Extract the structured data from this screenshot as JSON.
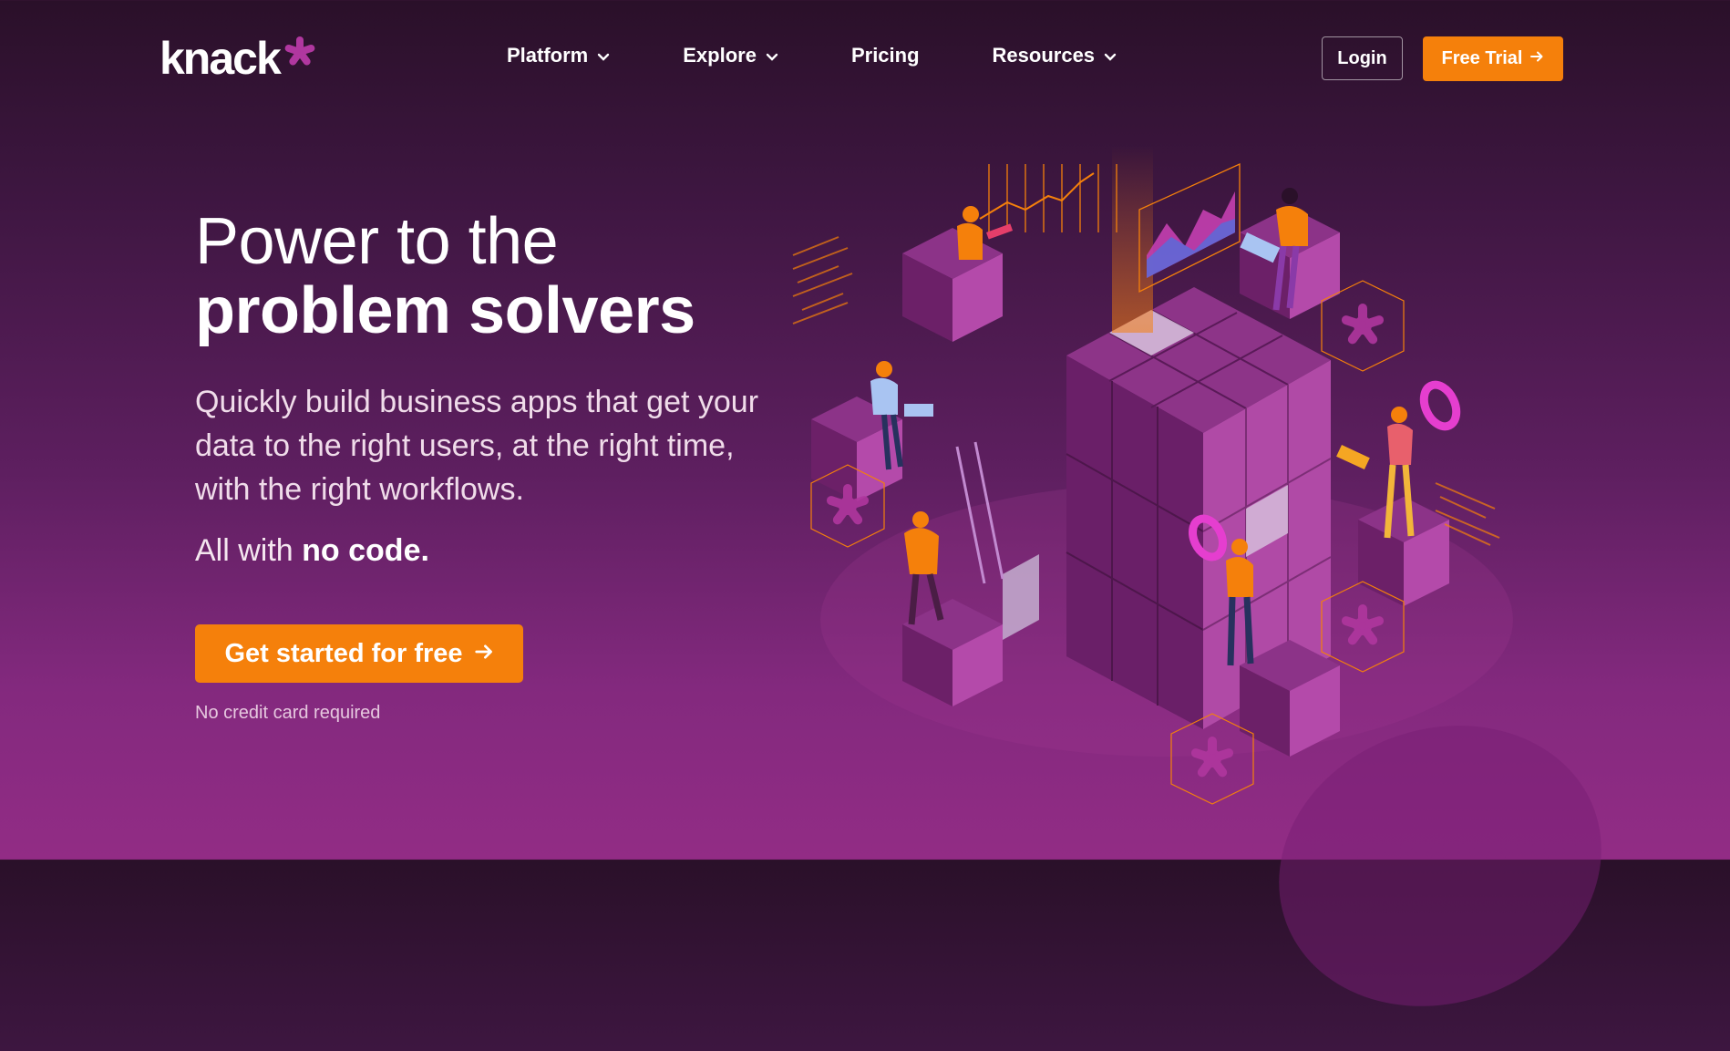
{
  "brand": {
    "logo_text": "knack",
    "accent": "#f5800b",
    "logo_star_color": "#b0379f"
  },
  "nav": {
    "items": [
      {
        "label": "Platform",
        "has_dropdown": true
      },
      {
        "label": "Explore",
        "has_dropdown": true
      },
      {
        "label": "Pricing",
        "has_dropdown": false
      },
      {
        "label": "Resources",
        "has_dropdown": true
      }
    ],
    "login_label": "Login",
    "trial_label": "Free Trial"
  },
  "hero": {
    "headline_line1": "Power to the",
    "headline_line2": "problem solvers",
    "subtitle": "Quickly build business apps that get your data to the right users, at the right time, with the right workflows.",
    "tagline_prefix": "All with ",
    "tagline_bold": "no code.",
    "cta_label": "Get started for free",
    "note": "No credit card required"
  },
  "icons": {
    "dropdown": "chevron-down-icon",
    "arrow": "arrow-right-icon",
    "logo": "asterisk-icon"
  }
}
